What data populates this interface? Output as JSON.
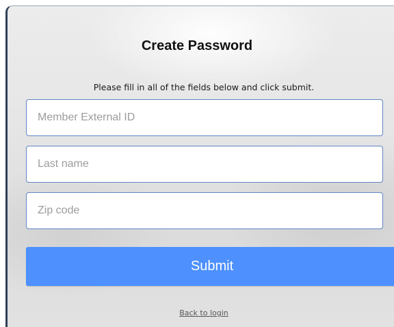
{
  "form": {
    "title": "Create Password",
    "instructions": "Please fill in all of the fields below and click submit.",
    "fields": [
      {
        "placeholder": "Member External ID",
        "value": ""
      },
      {
        "placeholder": "Last name",
        "value": ""
      },
      {
        "placeholder": "Zip code",
        "value": ""
      }
    ],
    "submit_label": "Submit",
    "back_link_label": "Back to login"
  },
  "colors": {
    "button_bg": "#4d90fe",
    "field_border": "#5f84c7",
    "panel_bg": "#e6e6e6"
  }
}
